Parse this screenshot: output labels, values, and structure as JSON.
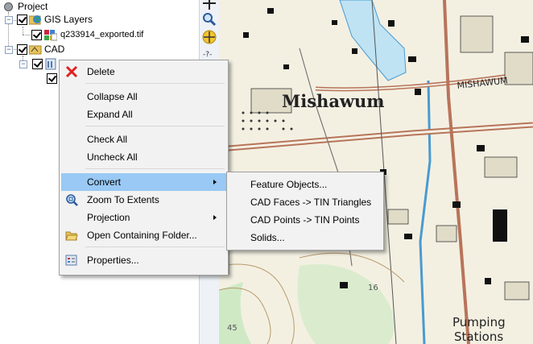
{
  "tree": {
    "root_label": "Project",
    "items": [
      {
        "label": "GIS Layers"
      },
      {
        "label": "q233914_exported.tif"
      },
      {
        "label": "CAD"
      }
    ]
  },
  "context_menu": {
    "items": [
      {
        "label": "Delete",
        "icon": "delete-x-icon"
      },
      {
        "label": "Collapse All"
      },
      {
        "label": "Expand All"
      },
      {
        "label": "Check All"
      },
      {
        "label": "Uncheck All"
      },
      {
        "label": "Convert",
        "has_submenu": true,
        "highlighted": true
      },
      {
        "label": "Zoom To Extents",
        "icon": "zoom-extents-icon"
      },
      {
        "label": "Projection",
        "has_submenu": true
      },
      {
        "label": "Open Containing Folder...",
        "icon": "folder-icon"
      },
      {
        "label": "Properties...",
        "icon": "properties-icon"
      }
    ]
  },
  "submenu": {
    "items": [
      {
        "label": "Feature Objects..."
      },
      {
        "label": "CAD Faces -> TIN Triangles"
      },
      {
        "label": "CAD Points -> TIN Points"
      },
      {
        "label": "Solids..."
      }
    ]
  },
  "map": {
    "labels": {
      "town": "Mishawum",
      "road": "MISHAWUM",
      "station_line1": "Pumping",
      "station_line2": "Stations",
      "contour1": "16",
      "contour2": "45"
    }
  },
  "colors": {
    "menu_bg": "#f2f2f2",
    "highlight": "#99c9f4",
    "map_bg": "#f3f0e2",
    "water": "#bfe3f3",
    "road": "#b8745a"
  }
}
